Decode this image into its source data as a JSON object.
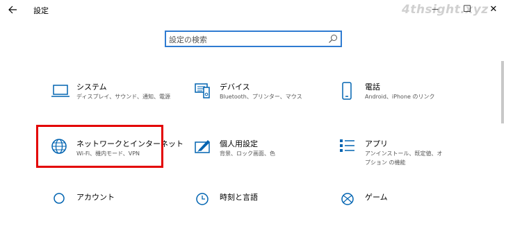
{
  "window": {
    "title": "設定",
    "watermark": "4thsight.xyz",
    "minimize": "—",
    "maximize": "☐",
    "close": "✕"
  },
  "search": {
    "placeholder": "設定の検索"
  },
  "tiles": [
    {
      "title": "システム",
      "desc": "ディスプレイ、サウンド、通知、電源",
      "icon": "laptop-icon"
    },
    {
      "title": "デバイス",
      "desc": "Bluetooth、プリンター、マウス",
      "icon": "devices-icon"
    },
    {
      "title": "電話",
      "desc": "Android、iPhone のリンク",
      "icon": "phone-icon"
    },
    {
      "title": "ネットワークとインターネット",
      "desc": "Wi-Fi、機内モード、VPN",
      "icon": "globe-icon"
    },
    {
      "title": "個人用設定",
      "desc": "背景、ロック画面、色",
      "icon": "personalization-icon"
    },
    {
      "title": "アプリ",
      "desc": "アンインストール、既定値、オプション の機能",
      "icon": "apps-list-icon"
    },
    {
      "title": "アカウント",
      "desc": "",
      "icon": "account-icon"
    },
    {
      "title": "時刻と言語",
      "desc": "",
      "icon": "time-language-icon"
    },
    {
      "title": "ゲーム",
      "desc": "",
      "icon": "xbox-icon"
    }
  ],
  "colors": {
    "accent": "#0063b1",
    "highlight": "#e30000",
    "search_border": "#2f7bd1"
  }
}
